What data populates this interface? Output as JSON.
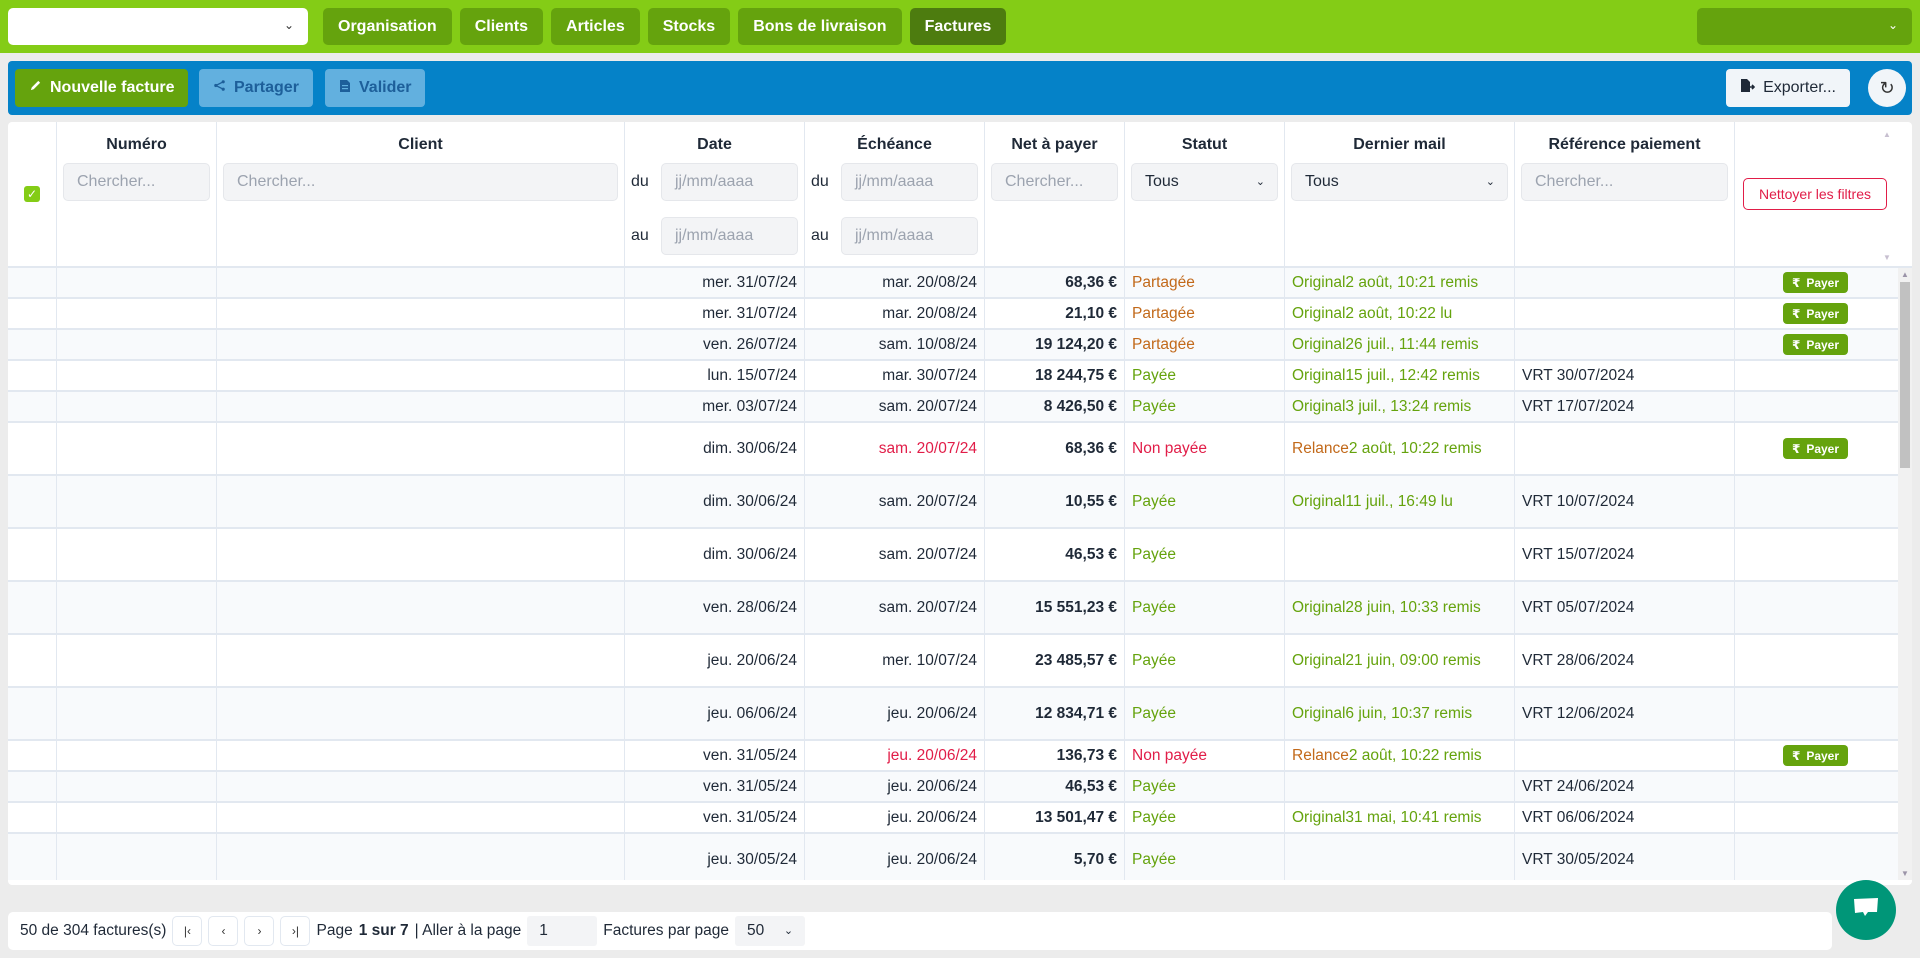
{
  "nav": {
    "org_select_value": "",
    "tabs": [
      {
        "label": "Organisation",
        "active": false
      },
      {
        "label": "Clients",
        "active": false
      },
      {
        "label": "Articles",
        "active": false
      },
      {
        "label": "Stocks",
        "active": false
      },
      {
        "label": "Bons de livraison",
        "active": false
      },
      {
        "label": "Factures",
        "active": true
      }
    ],
    "user_select_value": ""
  },
  "actions": {
    "new_invoice": "Nouvelle facture",
    "share": "Partager",
    "validate": "Valider",
    "export": "Exporter..."
  },
  "table": {
    "columns": {
      "number": "Numéro",
      "client": "Client",
      "date": "Date",
      "due": "Échéance",
      "net": "Net à payer",
      "status": "Statut",
      "last_mail": "Dernier mail",
      "payment_ref": "Référence paiement"
    },
    "filters": {
      "search_placeholder": "Chercher...",
      "date_placeholder": "jj/mm/aaaa",
      "from_label": "du",
      "to_label": "au",
      "status_value": "Tous",
      "last_mail_value": "Tous",
      "clear_filters": "Nettoyer les filtres"
    },
    "pay_label": "Payer",
    "rows": [
      {
        "date": "mer. 31/07/24",
        "due": "mar. 20/08/24",
        "due_late": false,
        "net": "68,36 €",
        "status": "Partagée",
        "status_kind": "shared",
        "mail_kind": "Original",
        "mail_rest": " 2 août, 10:21 remis",
        "ref": "",
        "pay": true,
        "h": "h30"
      },
      {
        "date": "mer. 31/07/24",
        "due": "mar. 20/08/24",
        "due_late": false,
        "net": "21,10 €",
        "status": "Partagée",
        "status_kind": "shared",
        "mail_kind": "Original",
        "mail_rest": " 2 août, 10:22 lu",
        "ref": "",
        "pay": true,
        "h": "h30"
      },
      {
        "date": "ven. 26/07/24",
        "due": "sam. 10/08/24",
        "due_late": false,
        "net": "19 124,20 €",
        "status": "Partagée",
        "status_kind": "shared",
        "mail_kind": "Original",
        "mail_rest": " 26 juil., 11:44 remis",
        "ref": "",
        "pay": true,
        "h": "h30"
      },
      {
        "date": "lun. 15/07/24",
        "due": "mar. 30/07/24",
        "due_late": false,
        "net": "18 244,75 €",
        "status": "Payée",
        "status_kind": "paid",
        "mail_kind": "Original",
        "mail_rest": " 15 juil., 12:42 remis",
        "ref": "VRT 30/07/2024",
        "pay": false,
        "h": "h30"
      },
      {
        "date": "mer. 03/07/24",
        "due": "sam. 20/07/24",
        "due_late": false,
        "net": "8 426,50 €",
        "status": "Payée",
        "status_kind": "paid",
        "mail_kind": "Original",
        "mail_rest": " 3 juil., 13:24 remis",
        "ref": "VRT 17/07/2024",
        "pay": false,
        "h": "h30"
      },
      {
        "date": "dim. 30/06/24",
        "due": "sam. 20/07/24",
        "due_late": true,
        "net": "68,36 €",
        "status": "Non payée",
        "status_kind": "unpaid",
        "mail_kind": "Relance",
        "mail_rest": " 2 août, 10:22 remis",
        "ref": "",
        "pay": true,
        "h": "h53"
      },
      {
        "date": "dim. 30/06/24",
        "due": "sam. 20/07/24",
        "due_late": false,
        "net": "10,55 €",
        "status": "Payée",
        "status_kind": "paid",
        "mail_kind": "Original",
        "mail_rest": " 11 juil., 16:49 lu",
        "ref": "VRT 10/07/2024",
        "pay": false,
        "h": "h53"
      },
      {
        "date": "dim. 30/06/24",
        "due": "sam. 20/07/24",
        "due_late": false,
        "net": "46,53 €",
        "status": "Payée",
        "status_kind": "paid",
        "mail_kind": "",
        "mail_rest": "",
        "ref": "VRT 15/07/2024",
        "pay": false,
        "h": "h53"
      },
      {
        "date": "ven. 28/06/24",
        "due": "sam. 20/07/24",
        "due_late": false,
        "net": "15 551,23 €",
        "status": "Payée",
        "status_kind": "paid",
        "mail_kind": "Original",
        "mail_rest": " 28 juin, 10:33 remis",
        "ref": "VRT 05/07/2024",
        "pay": false,
        "h": "h53"
      },
      {
        "date": "jeu. 20/06/24",
        "due": "mer. 10/07/24",
        "due_late": false,
        "net": "23 485,57 €",
        "status": "Payée",
        "status_kind": "paid",
        "mail_kind": "Original",
        "mail_rest": " 21 juin, 09:00 remis",
        "ref": "VRT 28/06/2024",
        "pay": false,
        "h": "h53"
      },
      {
        "date": "jeu. 06/06/24",
        "due": "jeu. 20/06/24",
        "due_late": false,
        "net": "12 834,71 €",
        "status": "Payée",
        "status_kind": "paid",
        "mail_kind": "Original",
        "mail_rest": " 6 juin, 10:37 remis",
        "ref": "VRT 12/06/2024",
        "pay": false,
        "h": "h53"
      },
      {
        "date": "ven. 31/05/24",
        "due": "jeu. 20/06/24",
        "due_late": true,
        "net": "136,73 €",
        "status": "Non payée",
        "status_kind": "unpaid",
        "mail_kind": "Relance",
        "mail_rest": " 2 août, 10:22 remis",
        "ref": "",
        "pay": true,
        "h": "h30"
      },
      {
        "date": "ven. 31/05/24",
        "due": "jeu. 20/06/24",
        "due_late": false,
        "net": "46,53 €",
        "status": "Payée",
        "status_kind": "paid",
        "mail_kind": "",
        "mail_rest": "",
        "ref": "VRT 24/06/2024",
        "pay": false,
        "h": "h30"
      },
      {
        "date": "ven. 31/05/24",
        "due": "jeu. 20/06/24",
        "due_late": false,
        "net": "13 501,47 €",
        "status": "Payée",
        "status_kind": "paid",
        "mail_kind": "Original",
        "mail_rest": " 31 mai, 10:41 remis",
        "ref": "VRT 06/06/2024",
        "pay": false,
        "h": "h30"
      },
      {
        "date": "jeu. 30/05/24",
        "due": "jeu. 20/06/24",
        "due_late": false,
        "net": "5,70 €",
        "status": "Payée",
        "status_kind": "paid",
        "mail_kind": "",
        "mail_rest": "",
        "ref": "VRT 30/05/2024",
        "pay": false,
        "h": "h53"
      },
      {
        "date": "",
        "due": "",
        "due_late": false,
        "net": "",
        "status": "",
        "status_kind": "paid",
        "mail_kind": "",
        "mail_rest": "",
        "ref": "",
        "pay": false,
        "h": "h53"
      }
    ]
  },
  "pagination": {
    "count_text": "50 de 304 factures(s)",
    "page_prefix": "Page",
    "page_current": "1 sur 7",
    "goto_label": "| Aller à la page",
    "goto_value": "1",
    "per_page_label": "Factures par page",
    "per_page_value": "50"
  },
  "colors": {
    "nav_bg": "#84cc16",
    "nav_tab": "#65a30d",
    "nav_tab_active": "#4d7c0f",
    "actionbar_bg": "#0582c8",
    "paid": "#65a30d",
    "shared": "#c2691a",
    "unpaid": "#e11d48",
    "chat": "#009678"
  }
}
